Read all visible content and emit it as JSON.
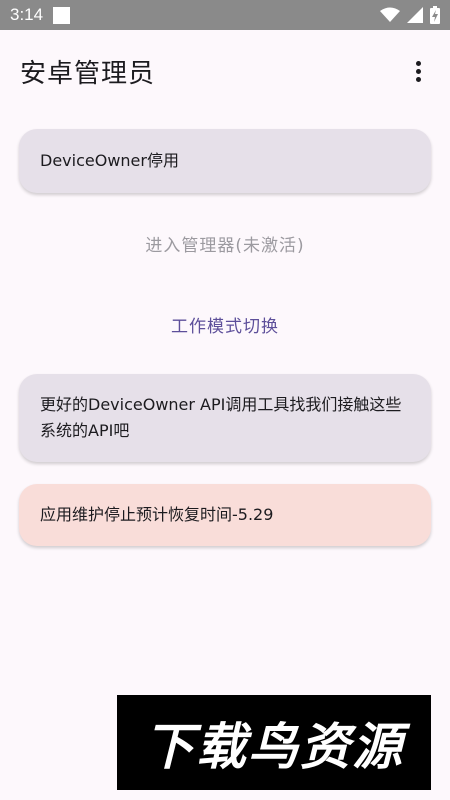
{
  "status_bar": {
    "time": "3:14",
    "icons": [
      "notification-square-icon",
      "wifi-icon",
      "signal-icon",
      "battery-charging-icon"
    ]
  },
  "app_bar": {
    "title": "安卓管理员",
    "menu_icon": "more-vert-icon"
  },
  "main": {
    "device_owner_card": "DeviceOwner停用",
    "enter_admin_button": "进入管理器(未激活)",
    "work_mode_button": "工作模式切换",
    "api_card": "更好的DeviceOwner API调用工具找我们接触这些系统的API吧",
    "maintenance_card": "应用维护停止预计恢复时间-5.29"
  },
  "watermark": "下载鸟资源",
  "colors": {
    "background": "#fdf8fc",
    "card": "#e6e0e9",
    "warning_card": "#f9ddd9",
    "accent": "#5d4f9a",
    "disabled": "#9c9aa0",
    "status_bar": "#8a8a8a"
  }
}
